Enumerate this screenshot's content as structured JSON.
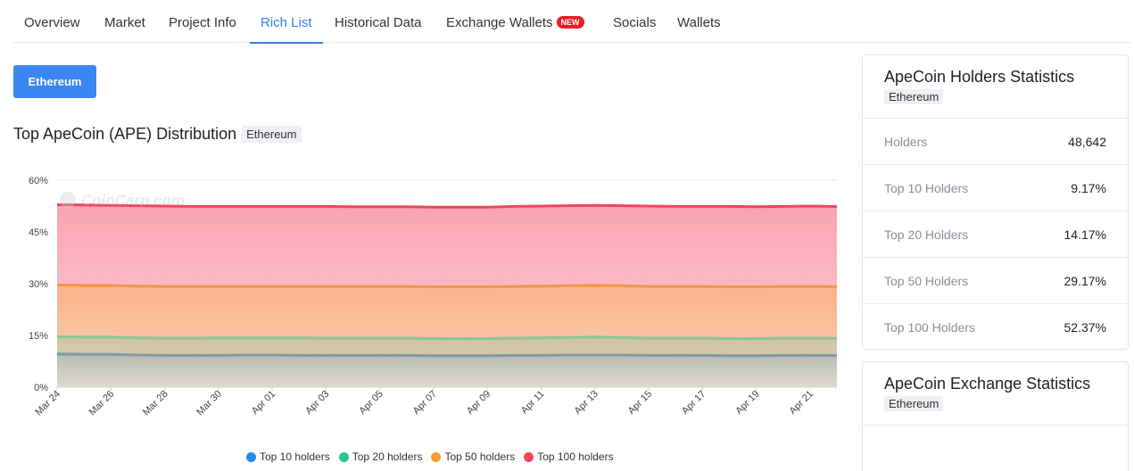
{
  "tabs": [
    {
      "label": "Overview"
    },
    {
      "label": "Market"
    },
    {
      "label": "Project Info"
    },
    {
      "label": "Rich List"
    },
    {
      "label": "Historical Data"
    },
    {
      "label": "Exchange Wallets",
      "badge": "NEW"
    },
    {
      "label": "Socials"
    },
    {
      "label": "Wallets"
    }
  ],
  "active_tab": "Rich List",
  "network_button": "Ethereum",
  "chart_section": {
    "title": "Top ApeCoin (APE) Distribution",
    "network_chip": "Ethereum",
    "watermark": "CoinCarp.com"
  },
  "chart_data": {
    "type": "area",
    "title": "Top ApeCoin (APE) Distribution",
    "xlabel": "",
    "ylabel": "",
    "ylim": [
      0,
      60
    ],
    "y_ticks": [
      "0%",
      "15%",
      "30%",
      "45%",
      "60%"
    ],
    "x_tick_labels": [
      "Mar 24",
      "Mar 26",
      "Mar 28",
      "Mar 30",
      "Apr 01",
      "Apr 03",
      "Apr 05",
      "Apr 07",
      "Apr 09",
      "Apr 11",
      "Apr 13",
      "Apr 15",
      "Apr 17",
      "Apr 19",
      "Apr 21"
    ],
    "x": [
      "Mar 24",
      "Mar 25",
      "Mar 26",
      "Mar 27",
      "Mar 28",
      "Mar 29",
      "Mar 30",
      "Mar 31",
      "Apr 01",
      "Apr 02",
      "Apr 03",
      "Apr 04",
      "Apr 05",
      "Apr 06",
      "Apr 07",
      "Apr 08",
      "Apr 09",
      "Apr 10",
      "Apr 11",
      "Apr 12",
      "Apr 13",
      "Apr 14",
      "Apr 15",
      "Apr 16",
      "Apr 17",
      "Apr 18",
      "Apr 19",
      "Apr 20",
      "Apr 21",
      "Apr 22"
    ],
    "grid": true,
    "legend_position": "bottom",
    "series": [
      {
        "name": "Top 100 holders",
        "color": "#f0455f",
        "values": [
          52.9,
          52.8,
          52.7,
          52.6,
          52.5,
          52.4,
          52.4,
          52.4,
          52.4,
          52.4,
          52.4,
          52.3,
          52.3,
          52.3,
          52.2,
          52.2,
          52.2,
          52.4,
          52.5,
          52.6,
          52.7,
          52.6,
          52.5,
          52.4,
          52.4,
          52.4,
          52.3,
          52.4,
          52.5,
          52.37
        ]
      },
      {
        "name": "Top 50 holders",
        "color": "#f5a030",
        "values": [
          29.6,
          29.5,
          29.5,
          29.3,
          29.2,
          29.2,
          29.2,
          29.2,
          29.2,
          29.2,
          29.2,
          29.2,
          29.2,
          29.2,
          29.1,
          29.1,
          29.1,
          29.2,
          29.3,
          29.4,
          29.5,
          29.4,
          29.2,
          29.2,
          29.2,
          29.1,
          29.1,
          29.2,
          29.2,
          29.17
        ]
      },
      {
        "name": "Top 20 holders",
        "color": "#25c98f",
        "values": [
          14.6,
          14.5,
          14.5,
          14.3,
          14.2,
          14.2,
          14.3,
          14.3,
          14.3,
          14.3,
          14.2,
          14.2,
          14.2,
          14.2,
          14.1,
          14.1,
          14.1,
          14.2,
          14.3,
          14.4,
          14.5,
          14.4,
          14.2,
          14.2,
          14.2,
          14.1,
          14.1,
          14.2,
          14.2,
          14.17
        ]
      },
      {
        "name": "Top 10 holders",
        "color": "#1e8ff0",
        "values": [
          9.6,
          9.5,
          9.5,
          9.3,
          9.2,
          9.2,
          9.2,
          9.3,
          9.3,
          9.2,
          9.2,
          9.2,
          9.2,
          9.2,
          9.1,
          9.1,
          9.1,
          9.2,
          9.2,
          9.3,
          9.3,
          9.3,
          9.2,
          9.2,
          9.2,
          9.1,
          9.1,
          9.2,
          9.2,
          9.17
        ]
      }
    ]
  },
  "legend": [
    {
      "label": "Top 10 holders",
      "color": "#1e8ff0"
    },
    {
      "label": "Top 20 holders",
      "color": "#25c98f"
    },
    {
      "label": "Top 50 holders",
      "color": "#f5a030"
    },
    {
      "label": "Top 100 holders",
      "color": "#f0455f"
    }
  ],
  "holders_card": {
    "title": "ApeCoin Holders Statistics",
    "chip": "Ethereum",
    "rows": [
      {
        "label": "Holders",
        "value": "48,642"
      },
      {
        "label": "Top 10 Holders",
        "value": "9.17%"
      },
      {
        "label": "Top 20 Holders",
        "value": "14.17%"
      },
      {
        "label": "Top 50 Holders",
        "value": "29.17%"
      },
      {
        "label": "Top 100 Holders",
        "value": "52.37%"
      }
    ]
  },
  "exchange_card": {
    "title": "ApeCoin Exchange Statistics",
    "chip": "Ethereum"
  }
}
